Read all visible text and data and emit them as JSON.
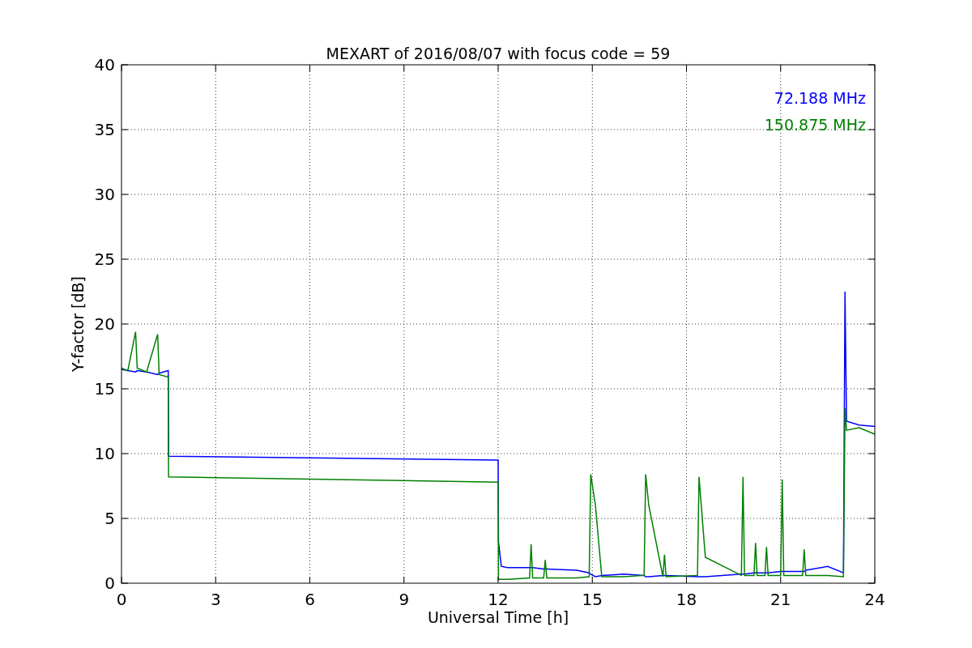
{
  "chart": {
    "chart_data": {
      "type": "line",
      "title": "MEXART of 2016/08/07 with focus code = 59",
      "xlabel": "Universal Time [h]",
      "ylabel": "Y-factor [dB]",
      "x": [
        0,
        0.2,
        0.45,
        0.5,
        0.8,
        1.15,
        1.2,
        1.49,
        1.5,
        12,
        12.01,
        12.1,
        12.3,
        13.0,
        13.05,
        13.1,
        13.45,
        13.5,
        13.55,
        14.5,
        14.9,
        14.95,
        15.1,
        15.3,
        16.0,
        16.65,
        16.7,
        16.8,
        17.25,
        17.3,
        17.35,
        18.35,
        18.4,
        18.6,
        19.75,
        19.8,
        19.85,
        20.15,
        20.2,
        20.25,
        20.5,
        20.55,
        20.6,
        21.0,
        21.05,
        21.1,
        21.7,
        21.75,
        21.8,
        22.5,
        23.0,
        23.05,
        23.1,
        23.5,
        24
      ],
      "series": [
        {
          "name": "72.188 MHz",
          "color": "#0000ff",
          "values": [
            16.5,
            16.4,
            16.3,
            16.4,
            16.3,
            16.1,
            16.2,
            16.4,
            9.8,
            9.5,
            3.2,
            1.3,
            1.2,
            1.2,
            1.2,
            1.2,
            1.1,
            1.1,
            1.1,
            1.0,
            0.8,
            0.7,
            0.5,
            0.6,
            0.7,
            0.6,
            0.5,
            0.5,
            0.6,
            0.6,
            0.6,
            0.5,
            0.5,
            0.5,
            0.7,
            0.7,
            0.7,
            0.8,
            0.8,
            0.8,
            0.8,
            0.8,
            0.8,
            0.9,
            0.9,
            0.9,
            0.9,
            0.9,
            1.0,
            1.3,
            0.8,
            22.5,
            12.5,
            12.2,
            12.1
          ]
        },
        {
          "name": "150.875 MHz",
          "color": "#008000",
          "values": [
            16.6,
            16.4,
            19.4,
            16.6,
            16.3,
            19.2,
            16.1,
            15.9,
            8.2,
            7.8,
            0.3,
            0.3,
            0.3,
            0.4,
            3.0,
            0.4,
            0.4,
            1.8,
            0.4,
            0.4,
            0.5,
            8.4,
            6.0,
            0.5,
            0.5,
            0.6,
            8.4,
            6.0,
            0.5,
            2.2,
            0.5,
            0.6,
            8.2,
            2.0,
            0.6,
            8.2,
            0.6,
            0.6,
            3.1,
            0.6,
            0.6,
            2.8,
            0.6,
            0.6,
            8.0,
            0.6,
            0.6,
            2.6,
            0.6,
            0.6,
            0.5,
            13.5,
            11.8,
            12.0,
            11.5
          ]
        }
      ],
      "grid": true,
      "xlim": [
        0,
        24
      ],
      "ylim": [
        0,
        40
      ],
      "xticks": [
        0,
        3,
        6,
        9,
        12,
        15,
        18,
        21,
        24
      ],
      "yticks": [
        0,
        5,
        10,
        15,
        20,
        25,
        30,
        35,
        40
      ]
    }
  }
}
